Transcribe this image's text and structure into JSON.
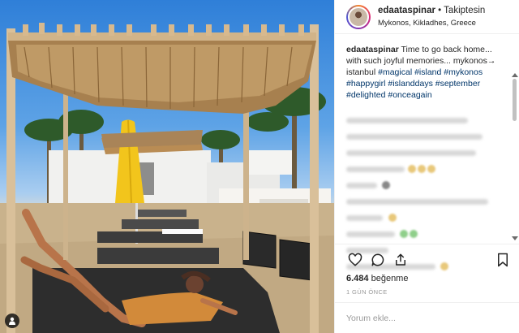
{
  "post": {
    "username": "edaataspinar",
    "separator": " • ",
    "follow_status": "Takiptesin",
    "location": "Mykonos, Kikladhes, Greece",
    "caption_text": "Time to go back home... with such joyful memories... mykonos→ istanbul",
    "hashtags": "#magical #island #mykonos #happygirl #islanddays #september #delighted #onceagain",
    "likes_count": "6.484",
    "likes_label": "beğenme",
    "time_ago": "1 GÜN ÖNCE",
    "comment_placeholder": "Yorum ekle..."
  },
  "icons": {
    "like": "heart-icon",
    "comment": "speech-bubble-icon",
    "share": "share-icon",
    "save": "bookmark-icon",
    "tagged_user": "user-icon"
  },
  "colors": {
    "hashtag": "#003569",
    "secondary_text": "#999999",
    "primary_text": "#262626"
  }
}
